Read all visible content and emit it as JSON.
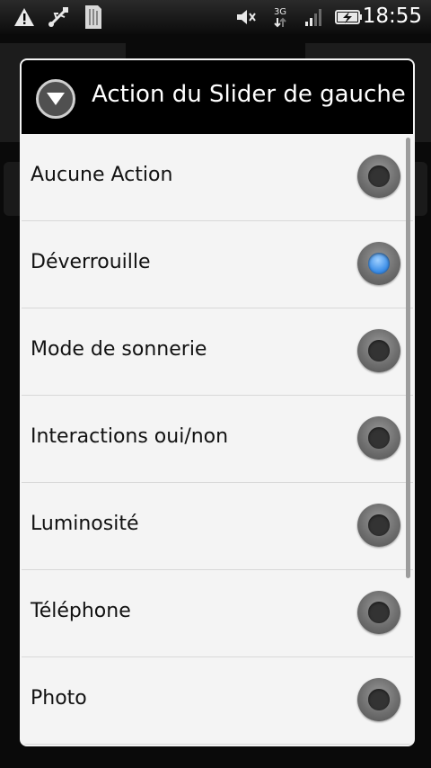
{
  "status_bar": {
    "time": "18:55",
    "network": "3G",
    "icons": [
      "warning-icon",
      "usb-icon",
      "sd-card-icon",
      "mute-icon",
      "network-3g-icon",
      "signal-icon",
      "battery-charging-icon"
    ]
  },
  "dialog": {
    "title": "Action du Slider de gauche",
    "header_icon": "chevron-down-icon",
    "options": [
      {
        "label": "Aucune Action",
        "selected": false
      },
      {
        "label": "Déverrouille",
        "selected": true
      },
      {
        "label": "Mode de sonnerie",
        "selected": false
      },
      {
        "label": "Interactions oui/non",
        "selected": false
      },
      {
        "label": "Luminosité",
        "selected": false
      },
      {
        "label": "Téléphone",
        "selected": false
      },
      {
        "label": "Photo",
        "selected": false
      }
    ]
  },
  "colors": {
    "selected_radio": "#3d8fe8",
    "list_bg": "#f4f4f4",
    "header_bg": "#000000"
  }
}
